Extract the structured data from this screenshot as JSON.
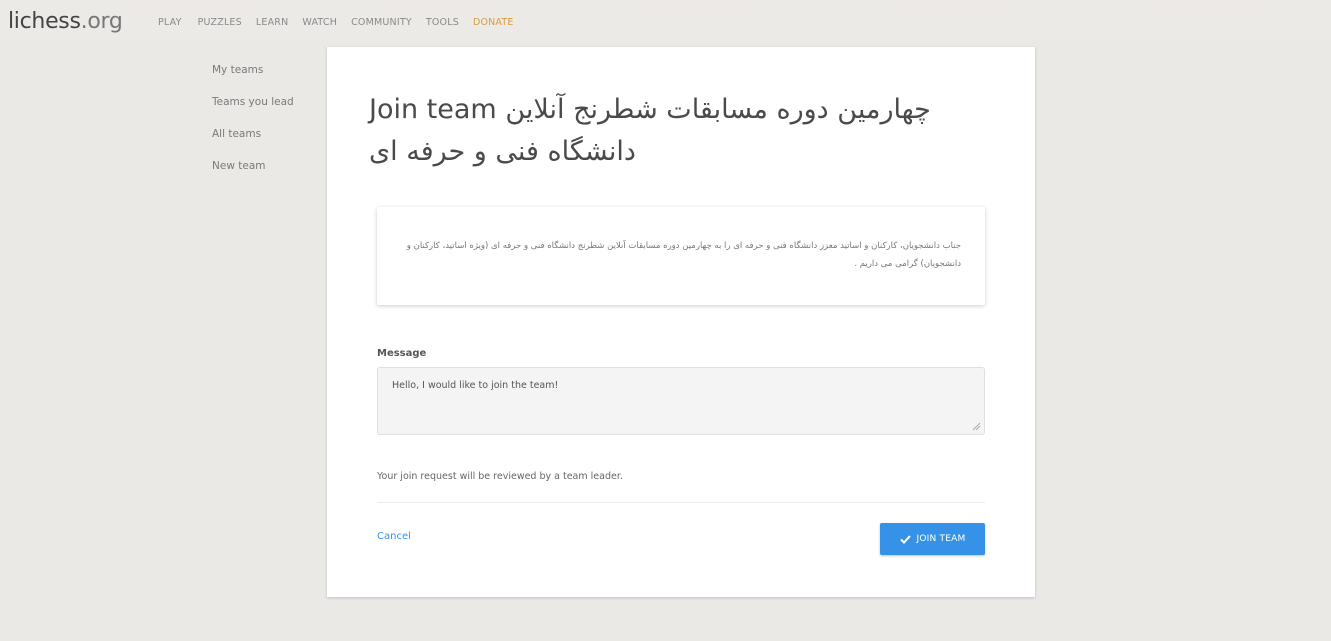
{
  "header": {
    "logo_main": "lichess",
    "logo_tld": ".org",
    "nav": [
      {
        "label": "PLAY"
      },
      {
        "label": "PUZZLES"
      },
      {
        "label": "LEARN"
      },
      {
        "label": "WATCH"
      },
      {
        "label": "COMMUNITY"
      },
      {
        "label": "TOOLS"
      },
      {
        "label": "DONATE"
      }
    ]
  },
  "subnav": {
    "items": [
      {
        "label": "My teams"
      },
      {
        "label": "Teams you lead"
      },
      {
        "label": "All teams"
      },
      {
        "label": "New team"
      }
    ]
  },
  "main": {
    "title": "Join team چهارمین دوره مسابقات شطرنج آنلاین دانشگاه فنی و حرفه ای",
    "description": "جناب دانشجویان، کارکنان و اساتید معزز دانشگاه فنی و حرفه ای را به چهارمین دوره مسابقات آنلاین شطرنج دانشگاه فنی و حرفه ای (ویژه اساتید، کارکنان و دانشجویان) گرامی می داریم .",
    "message_label": "Message",
    "message_value": "Hello, I would like to join the team!",
    "help_text": "Your join request will be reviewed by a team leader.",
    "cancel_label": "Cancel",
    "join_label": "JOIN TEAM"
  },
  "colors": {
    "accent": "#3692e7",
    "donate": "#d69d3f",
    "background": "#ebe9e6"
  },
  "icons": {
    "join": "checkmark-icon",
    "resize": "resize-grip-icon"
  }
}
